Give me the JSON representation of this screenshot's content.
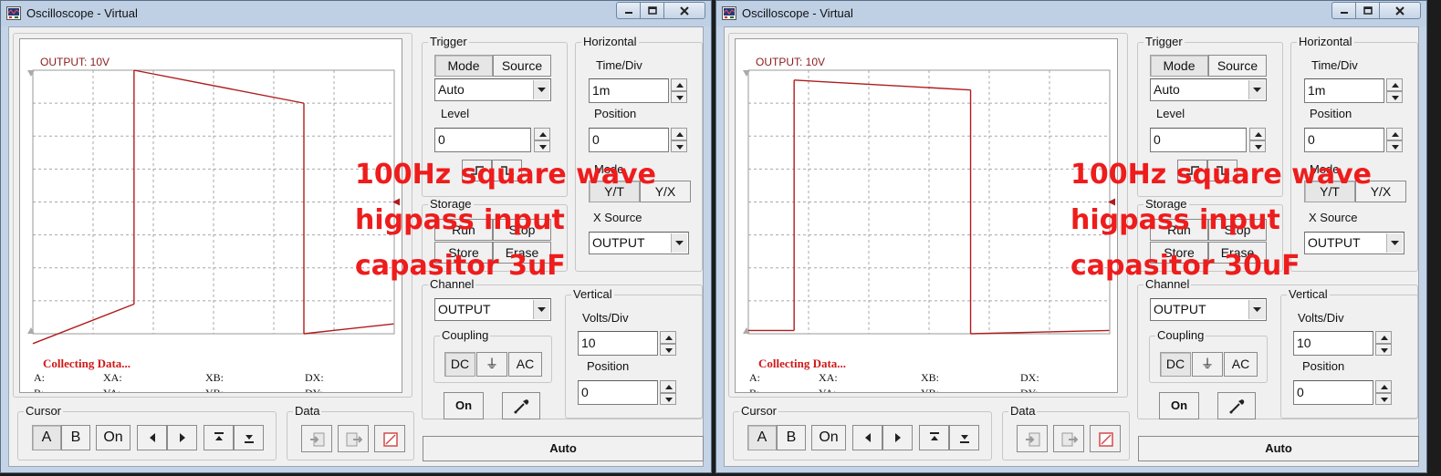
{
  "windows": [
    {
      "title": "Oscilloscope - Virtual",
      "screen_label": "OUTPUT: 10V",
      "status": "Collecting Data...",
      "measurements": {
        "a": "A:",
        "xa": "XA:",
        "xb": "XB:",
        "dx": "DX:",
        "b": "B:",
        "ya": "YA:",
        "yb": "YB:",
        "dy": "DY:"
      },
      "trigger": {
        "title": "Trigger",
        "mode_label": "Mode",
        "source_label": "Source",
        "mode_value": "Auto",
        "level_label": "Level",
        "level_value": "0"
      },
      "horizontal": {
        "title": "Horizontal",
        "time_div_label": "Time/Div",
        "time_div_value": "1m",
        "position_label": "Position",
        "position_value": "0",
        "mode_label": "Mode",
        "yt_label": "Y/T",
        "yx_label": "Y/X",
        "xsource_label": "X Source",
        "xsource_value": "OUTPUT"
      },
      "storage": {
        "title": "Storage",
        "run_label": "Run",
        "stop_label": "Stop",
        "store_label": "Store",
        "erase_label": "Erase"
      },
      "channel": {
        "title": "Channel",
        "value": "OUTPUT",
        "coupling_title": "Coupling",
        "dc_label": "DC",
        "gnd_label": "⏚",
        "ac_label": "AC",
        "on_label": "On"
      },
      "vertical": {
        "title": "Vertical",
        "volts_div_label": "Volts/Div",
        "volts_div_value": "10",
        "position_label": "Position",
        "position_value": "0"
      },
      "cursor": {
        "title": "Cursor",
        "a_label": "A",
        "b_label": "B",
        "on_label": "On"
      },
      "data_group": {
        "title": "Data"
      },
      "auto_label": "Auto",
      "overlay": {
        "line1": "100Hz square wave",
        "line2": "higpass input",
        "line3": "capasitor 3uF"
      },
      "trace": {
        "segments": [
          {
            "x0": 0.0,
            "y0": -4.3,
            "x1": 1.68,
            "y1": -3.1
          },
          {
            "x0": 1.68,
            "y0": -3.1,
            "x1": 1.68,
            "y1": 4.0
          },
          {
            "x0": 1.68,
            "y0": 4.0,
            "x1": 4.5,
            "y1": 3.0
          },
          {
            "x0": 4.5,
            "y0": 3.0,
            "x1": 4.5,
            "y1": -4.0
          },
          {
            "x0": 4.5,
            "y0": -4.0,
            "x1": 5.99,
            "y1": -3.7
          }
        ]
      }
    },
    {
      "title": "Oscilloscope - Virtual",
      "screen_label": "OUTPUT: 10V",
      "status": "Collecting Data...",
      "measurements": {
        "a": "A:",
        "xa": "XA:",
        "xb": "XB:",
        "dx": "DX:",
        "b": "B:",
        "ya": "YA:",
        "yb": "YB:",
        "dy": "DY:"
      },
      "trigger": {
        "title": "Trigger",
        "mode_label": "Mode",
        "source_label": "Source",
        "mode_value": "Auto",
        "level_label": "Level",
        "level_value": "0"
      },
      "horizontal": {
        "title": "Horizontal",
        "time_div_label": "Time/Div",
        "time_div_value": "1m",
        "position_label": "Position",
        "position_value": "0",
        "mode_label": "Mode",
        "yt_label": "Y/T",
        "yx_label": "Y/X",
        "xsource_label": "X Source",
        "xsource_value": "OUTPUT"
      },
      "storage": {
        "title": "Storage",
        "run_label": "Run",
        "stop_label": "Stop",
        "store_label": "Store",
        "erase_label": "Erase"
      },
      "channel": {
        "title": "Channel",
        "value": "OUTPUT",
        "coupling_title": "Coupling",
        "dc_label": "DC",
        "gnd_label": "⏚",
        "ac_label": "AC",
        "on_label": "On"
      },
      "vertical": {
        "title": "Vertical",
        "volts_div_label": "Volts/Div",
        "volts_div_value": "10",
        "position_label": "Position",
        "position_value": "0"
      },
      "cursor": {
        "title": "Cursor",
        "a_label": "A",
        "b_label": "B",
        "on_label": "On"
      },
      "data_group": {
        "title": "Data"
      },
      "auto_label": "Auto",
      "overlay": {
        "line1": "100Hz square wave",
        "line2": "higpass input",
        "line3": "capasitor 30uF"
      },
      "trace": {
        "segments": [
          {
            "x0": 0.0,
            "y0": -3.9,
            "x1": 0.76,
            "y1": -3.9
          },
          {
            "x0": 0.76,
            "y0": -3.9,
            "x1": 0.76,
            "y1": 3.7
          },
          {
            "x0": 0.76,
            "y0": 3.7,
            "x1": 3.69,
            "y1": 3.4
          },
          {
            "x0": 3.69,
            "y0": 3.4,
            "x1": 3.69,
            "y1": -4.0
          },
          {
            "x0": 3.69,
            "y0": -4.0,
            "x1": 5.99,
            "y1": -3.9
          }
        ]
      }
    }
  ],
  "colors": {
    "trace": "#b01c1c",
    "overlay_text": "#ee1c1c",
    "status_text": "#d01818",
    "grid": "#a8a8a8"
  }
}
